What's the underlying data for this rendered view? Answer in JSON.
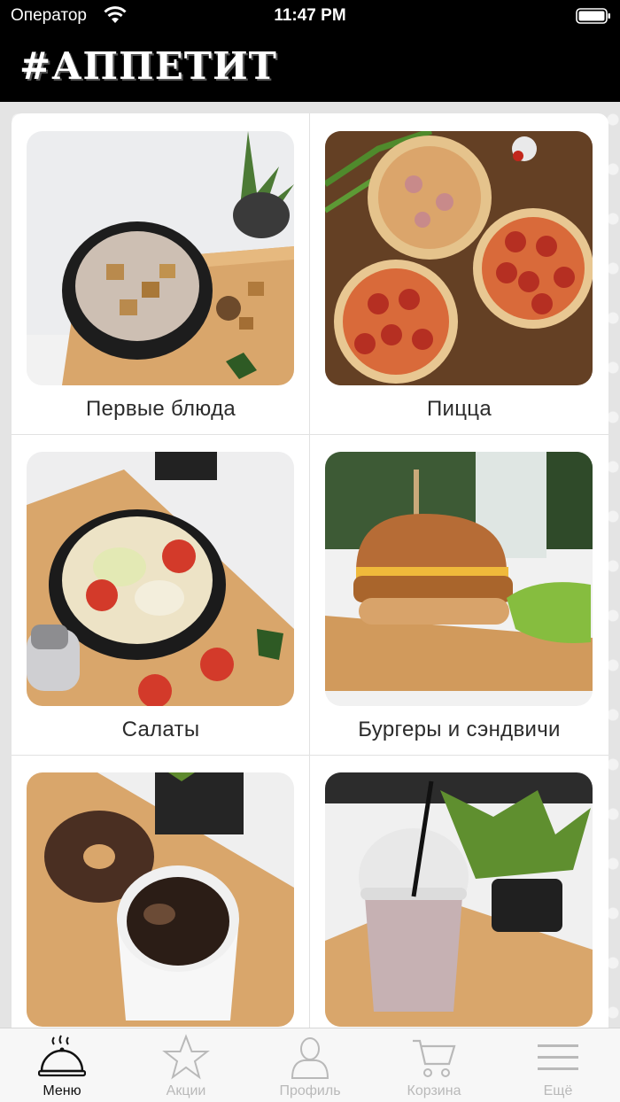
{
  "status_bar": {
    "carrier": "Оператор",
    "time": "11:47 PM"
  },
  "header": {
    "logo": "#АППЕТИТ"
  },
  "categories": [
    {
      "label": "Первые блюда",
      "photo": "soup-bowl-photo"
    },
    {
      "label": "Пицца",
      "photo": "pizza-board-photo"
    },
    {
      "label": "Салаты",
      "photo": "salad-bowl-photo"
    },
    {
      "label": "Бургеры и сэндвичи",
      "photo": "burger-photo"
    },
    {
      "label": "",
      "photo": "donut-coffee-photo"
    },
    {
      "label": "",
      "photo": "milkshake-photo"
    }
  ],
  "tabbar": {
    "items": [
      {
        "label": "Меню",
        "icon": "cloche-icon",
        "active": true
      },
      {
        "label": "Акции",
        "icon": "star-icon",
        "active": false
      },
      {
        "label": "Профиль",
        "icon": "person-icon",
        "active": false
      },
      {
        "label": "Корзина",
        "icon": "cart-icon",
        "active": false
      },
      {
        "label": "Ещё",
        "icon": "hamburger-menu-icon",
        "active": false
      }
    ]
  },
  "colors": {
    "header_bg": "#000000",
    "active_tab": "#111111",
    "inactive_tab": "#b9b9b9"
  }
}
